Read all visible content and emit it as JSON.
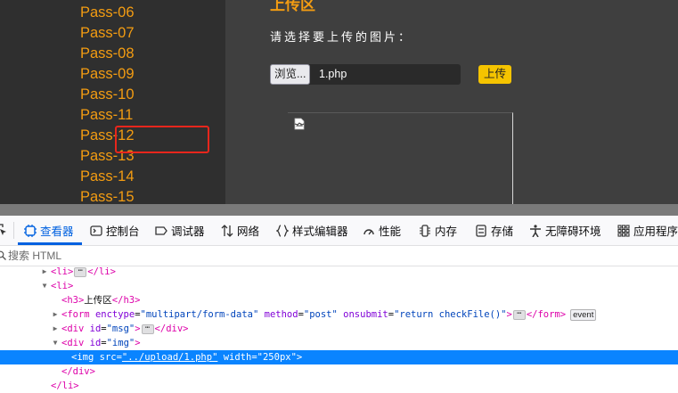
{
  "sidebar": {
    "items": [
      "Pass-06",
      "Pass-07",
      "Pass-08",
      "Pass-09",
      "Pass-10",
      "Pass-11",
      "Pass-12",
      "Pass-13",
      "Pass-14",
      "Pass-15"
    ]
  },
  "main": {
    "title": "上传区",
    "prompt": "请选择要上传的图片：",
    "browse_label": "浏览...",
    "file_name": "1.php",
    "upload_label": "上传"
  },
  "devtools": {
    "tabs": [
      {
        "label": "查看器",
        "icon": "inspector-icon"
      },
      {
        "label": "控制台",
        "icon": "console-icon"
      },
      {
        "label": "调试器",
        "icon": "debugger-icon"
      },
      {
        "label": "网络",
        "icon": "network-icon"
      },
      {
        "label": "样式编辑器",
        "icon": "style-editor-icon"
      },
      {
        "label": "性能",
        "icon": "performance-icon"
      },
      {
        "label": "内存",
        "icon": "memory-icon"
      },
      {
        "label": "存储",
        "icon": "storage-icon"
      },
      {
        "label": "无障碍环境",
        "icon": "accessibility-icon"
      },
      {
        "label": "应用程序",
        "icon": "application-icon"
      }
    ],
    "search_placeholder": "搜索 HTML",
    "tree": {
      "l0_open": "<li>",
      "l0_close": "</li>",
      "l1_open": "<li>",
      "h3_open": "<h3>",
      "h3_text": "上传区",
      "h3_close": "</h3>",
      "form_open": "<form",
      "form_attr1": "enctype",
      "form_val1": "\"multipart/form-data\"",
      "form_attr2": "method",
      "form_val2": "\"post\"",
      "form_attr3": "onsubmit",
      "form_val3": "\"return checkFile()\"",
      "form_gt": ">",
      "form_close": "</form>",
      "form_badge": "event",
      "msg_open": "<div",
      "msg_attr": "id",
      "msg_val": "\"msg\"",
      "msg_gt": ">",
      "msg_close": "</div>",
      "img_div_open": "<div",
      "img_div_attr": "id",
      "img_div_val": "\"img\"",
      "img_div_gt": ">",
      "img_open": "<img",
      "img_attr1": "src",
      "img_eq": "=",
      "img_val1": "\"../upload/1.php\"",
      "img_attr2": "width",
      "img_val2": "\"250px\"",
      "img_gt": ">",
      "div_close": "</div>",
      "li_close": "</li>"
    }
  },
  "colors": {
    "accent_orange": "#f39c12",
    "upload_button": "#f5c400",
    "selection_blue": "#0a84ff",
    "highlight_red": "#e8261c"
  }
}
